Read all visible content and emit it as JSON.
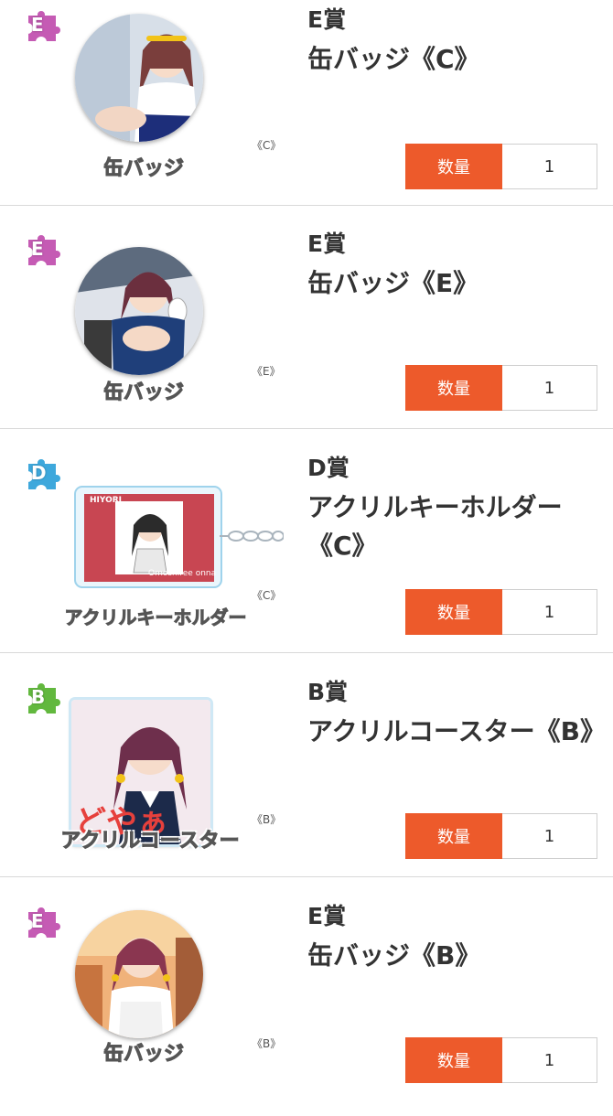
{
  "items": [
    {
      "rank": "E",
      "rank_color": "#c55bb4",
      "prize": "E賞",
      "product": "缶バッジ《C》",
      "type_label": "缶バッジ",
      "variant": "《C》",
      "art": "badge",
      "qty_label": "数量",
      "qty_value": "1"
    },
    {
      "rank": "E",
      "rank_color": "#c55bb4",
      "prize": "E賞",
      "product": "缶バッジ《E》",
      "type_label": "缶バッジ",
      "variant": "《E》",
      "art": "badge",
      "qty_label": "数量",
      "qty_value": "1"
    },
    {
      "rank": "D",
      "rank_color": "#3ea8dc",
      "prize": "D賞",
      "product": "アクリルキーホルダー《C》",
      "type_label": "アクリルキーホルダー",
      "variant": "《C》",
      "art": "keyholder",
      "card_title": "HIYORI",
      "card_caption": "Omoshiree onna",
      "qty_label": "数量",
      "qty_value": "1"
    },
    {
      "rank": "B",
      "rank_color": "#62b83e",
      "prize": "B賞",
      "product": "アクリルコースター《B》",
      "type_label": "アクリルコースター",
      "variant": "《B》",
      "art": "coaster",
      "coaster_text": "どやぁ",
      "qty_label": "数量",
      "qty_value": "1"
    },
    {
      "rank": "E",
      "rank_color": "#c55bb4",
      "prize": "E賞",
      "product": "缶バッジ《B》",
      "type_label": "缶バッジ",
      "variant": "《B》",
      "art": "badge",
      "qty_label": "数量",
      "qty_value": "1"
    }
  ]
}
